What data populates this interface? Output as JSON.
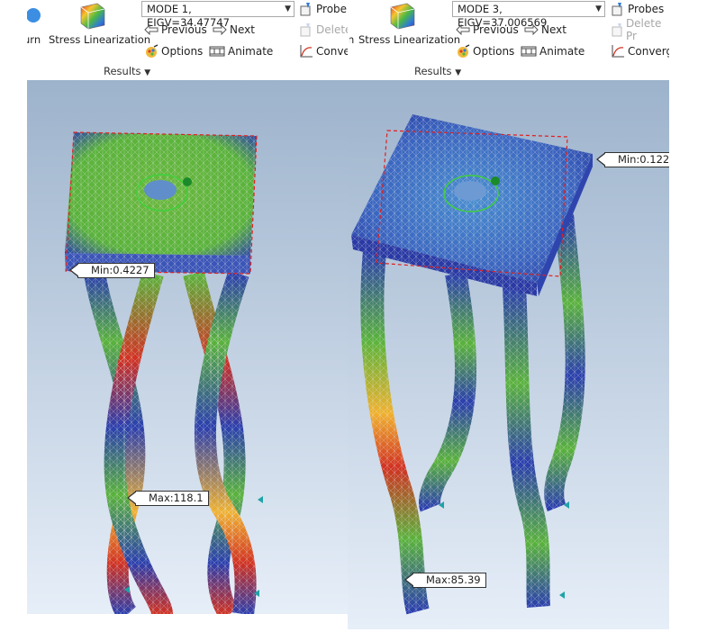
{
  "left_panel": {
    "partial_button": "urn",
    "stress_linearization": "Stress Linearization",
    "mode_select": "MODE 1, EIGV=34.47747",
    "probes": "Probe",
    "previous": "Previous",
    "next": "Next",
    "delete": "Delete",
    "options": "Options",
    "animate": "Animate",
    "convergence": "Conve",
    "results_group": "Results",
    "min_label": "Min:0.4227",
    "max_label": "Max:118.1"
  },
  "right_panel": {
    "partial_button": "n",
    "stress_linearization": "Stress Linearization",
    "mode_select": "MODE 3, EIGV=37.006569",
    "probes": "Probes",
    "previous": "Previous",
    "next": "Next",
    "delete": "Delete Pr",
    "options": "Options",
    "animate": "Animate",
    "convergence": "Converg",
    "results_group": "Results",
    "min_label": "Min:0.122",
    "max_label": "Max:85.39"
  },
  "colors": {
    "viewport_top": "#9db3cc",
    "viewport_bottom": "#e6eef8",
    "stress_low": "#2b3fae",
    "stress_mid": "#5ab33c",
    "stress_high": "#d23222",
    "mesh_line": "#e8e8e8",
    "boundary_dash": "#e02020"
  },
  "icons": {
    "stress_linearization": "rainbow-cube-icon",
    "previous": "arrow-left-icon",
    "next": "arrow-right-icon",
    "probes": "probe-icon",
    "delete": "delete-probe-icon",
    "options": "options-palette-icon",
    "animate": "film-strip-icon",
    "convergence": "convergence-graph-icon"
  }
}
